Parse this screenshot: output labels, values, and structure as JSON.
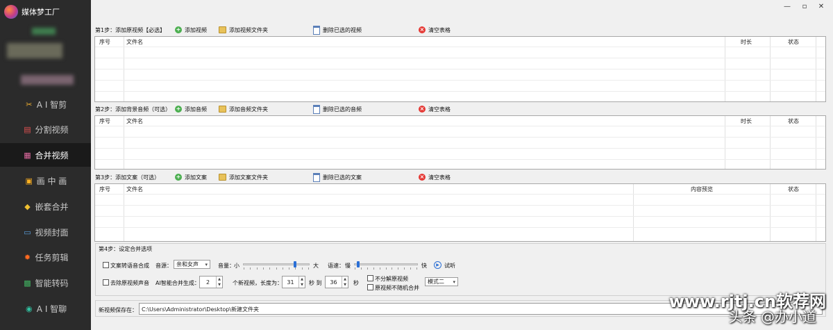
{
  "app": {
    "name": "媒体梦工厂"
  },
  "window": {
    "minimize": "—",
    "maximize": "▫",
    "close": "✕"
  },
  "sidebar": {
    "items": [
      {
        "label": "A I 智剪",
        "icon": "ai-clip-icon",
        "glyph": "✂",
        "color": "#f0b030"
      },
      {
        "label": "分割视频",
        "icon": "split-video-icon",
        "glyph": "▤",
        "color": "#e05050"
      },
      {
        "label": "合并视频",
        "icon": "merge-video-icon",
        "glyph": "▦",
        "color": "#e06aa0",
        "active": true
      },
      {
        "label": "画 中 画",
        "icon": "picture-in-picture-icon",
        "glyph": "▣",
        "color": "#ffb020"
      },
      {
        "label": "嵌套合并",
        "icon": "nested-merge-icon",
        "glyph": "◆",
        "color": "#f0c030"
      },
      {
        "label": "视频封面",
        "icon": "video-cover-icon",
        "glyph": "▭",
        "color": "#5aa0e0"
      },
      {
        "label": "任务剪辑",
        "icon": "task-edit-icon",
        "glyph": "✹",
        "color": "#ff6a20"
      },
      {
        "label": "智能转码",
        "icon": "smart-transcode-icon",
        "glyph": "▩",
        "color": "#40b060"
      },
      {
        "label": "A I 智聊",
        "icon": "ai-chat-icon",
        "glyph": "◉",
        "color": "#30c0a0"
      }
    ]
  },
  "step1": {
    "title": "第1步：添加原视频【必选】",
    "add": "添加视频",
    "add_folder": "添加视频文件夹",
    "delete": "删除已选的视频",
    "clear": "清空表格",
    "columns": [
      "序号",
      "文件名",
      "时长",
      "状态"
    ]
  },
  "step2": {
    "title": "第2步：添加背景音频（可选）",
    "add": "添加音频",
    "add_folder": "添加音频文件夹",
    "delete": "删除已选的音频",
    "clear": "清空表格",
    "columns": [
      "序号",
      "文件名",
      "时长",
      "状态"
    ]
  },
  "step3": {
    "title": "第3步：添加文案（可选）",
    "add": "添加文案",
    "add_folder": "添加文案文件夹",
    "delete": "删除已选的文案",
    "clear": "清空表格",
    "columns": [
      "序号",
      "文件名",
      "内容预览",
      "状态"
    ]
  },
  "step4": {
    "title": "第4步：设定合并选项",
    "tts_checkbox": "文案转语音合成",
    "voice_label": "音源：",
    "voice_value": "亲和女声",
    "volume_label": "音量：",
    "volume_min": "小",
    "volume_max": "大",
    "volume_level": 0.8,
    "speed_label": "语速：",
    "speed_min": "慢",
    "speed_max": "快",
    "speed_level": 0.03,
    "preview": "试听",
    "remove_audio": "去除原视频声音",
    "ai_generate_label": "AI智能合并生成：",
    "count_value": "2",
    "count_suffix": "个新视频，长度为：",
    "len_from": "31",
    "sec1": "秒 到",
    "len_to": "36",
    "sec2": "秒",
    "no_split": "不分解原视频",
    "no_random": "原视频不随机合并",
    "mode_value": "模式二"
  },
  "save": {
    "label": "新视频保存在：",
    "path": "C:\\Users\\Administrator\\Desktop\\新建文件夹"
  },
  "watermark": {
    "line1": "www.rjtj.cn软荐网",
    "line2": "头条 @办小道"
  }
}
